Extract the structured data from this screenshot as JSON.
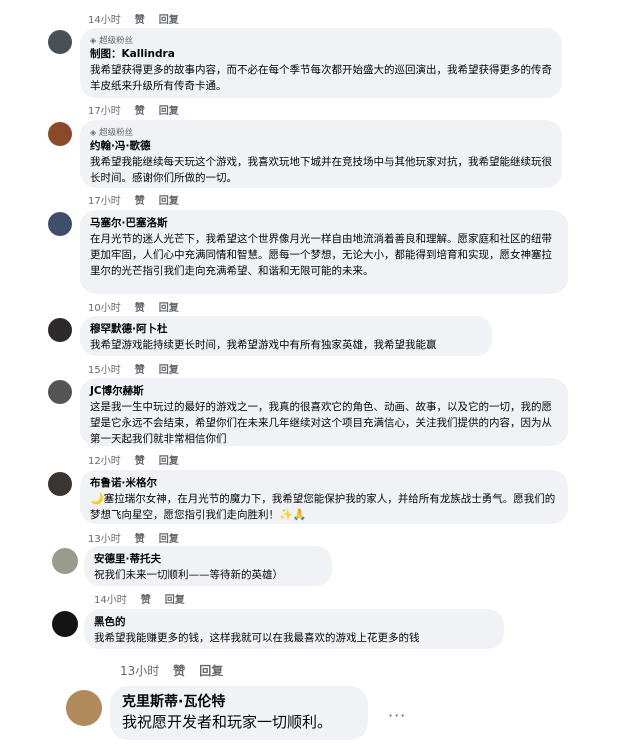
{
  "top": {
    "time": "14小时",
    "like": "赞",
    "reply": "回复"
  },
  "comments": [
    {
      "badge": "超级粉丝",
      "name": "制图：Kallindra",
      "text": "我希望获得更多的故事内容，而不必在每个季节每次都开始盛大的巡回演出，我希望获得更多的传奇羊皮纸来升级所有传奇卡通。",
      "time": "17小时",
      "like": "赞",
      "reply": "回复"
    },
    {
      "badge": "超级粉丝",
      "name": "约翰·冯·歌德",
      "text": "我希望我能继续每天玩这个游戏，我喜欢玩地下城并在竞技场中与其他玩家对抗，我希望能继续玩很长时间。感谢你们所做的一切。",
      "time": "17小时",
      "like": "赞",
      "reply": "回复"
    },
    {
      "name": "马塞尔·巴塞洛斯",
      "text": "在月光节的迷人光芒下，我希望这个世界像月光一样自由地流淌着善良和理解。愿家庭和社区的纽带更加牢固，人们心中充满同情和智慧。愿每一个梦想，无论大小，都能得到培育和实现，愿女神塞拉里尔的光芒指引我们走向充满希望、和谐和无限可能的未来。",
      "time": "10小时",
      "like": "赞",
      "reply": "回复"
    },
    {
      "name": "穆罕默德·阿卜杜",
      "text": "我希望游戏能持续更长时间，我希望游戏中有所有独家英雄，我希望我能赢",
      "time": "15小时",
      "like": "赞",
      "reply": "回复"
    },
    {
      "name": "JC博尔赫斯",
      "text": "这是我一生中玩过的最好的游戏之一，我真的很喜欢它的角色、动画、故事，以及它的一切，我的愿望是它永远不会结束，希望你们在未来几年继续对这个项目充满信心，关注我们提供的内容，因为从第一天起我们就非常相信你们",
      "time": "12小时",
      "like": "赞",
      "reply": "回复"
    },
    {
      "name": "布鲁诺·米格尔",
      "emoji_lead": "🌙",
      "text": "塞拉瑞尔女神，在月光节的魔力下，我希望您能保护我的家人，并给所有龙族战士勇气。愿我们的梦想飞向星空，愿您指引我们走向胜利！",
      "emoji_tail": "✨🙏",
      "time": "13小时",
      "like": "赞",
      "reply": "回复"
    },
    {
      "name": "安德里·蒂托夫",
      "text": "祝我们未来一切顺利——等待新的英雄）",
      "time": "14小时",
      "like": "赞",
      "reply": "回复"
    },
    {
      "name": "黑色的",
      "text": "我希望我能赚更多的钱，这样我就可以在我最喜欢的游戏上花更多的钱",
      "time": "13小时",
      "like": "赞",
      "reply": "回复"
    },
    {
      "name": "克里斯蒂·瓦伦特",
      "text": "我祝愿开发者和玩家一切顺利。",
      "more": "···"
    }
  ],
  "icon_names": [
    "gem-icon",
    "more-options-icon"
  ]
}
